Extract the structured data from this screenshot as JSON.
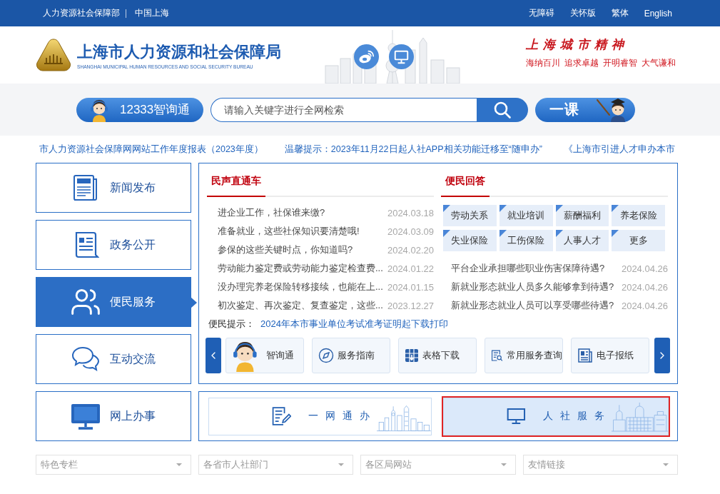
{
  "top_bar": {
    "left_links": [
      "人力资源社会保障部",
      "中国上海"
    ],
    "right_links": [
      "无障碍",
      "关怀版",
      "繁体",
      "English"
    ]
  },
  "header": {
    "title": "上海市人力资源和社会保障局",
    "subtitle": "SHANGHAI MUNICIPAL HUMAN RESOURCES AND SOCIAL SECURITY BUREAU",
    "motto_title": "上海城市精神",
    "mottos": [
      "海纳百川",
      "追求卓越",
      "开明睿智",
      "大气谦和"
    ]
  },
  "search_bar": {
    "hotline_button": "12333智询通",
    "placeholder": "请输入关键字进行全网检索",
    "course_button": "一课"
  },
  "ticker": [
    "市人力资源社会保障网网站工作年度报表（2023年度）",
    "温馨提示：2023年11月22日起人社APP相关功能迁移至“随申办”",
    "《上海市引进人才申办本市"
  ],
  "nav": [
    {
      "label": "新闻发布",
      "selected": false
    },
    {
      "label": "政务公开",
      "selected": false
    },
    {
      "label": "便民服务",
      "selected": true
    },
    {
      "label": "互动交流",
      "selected": false
    },
    {
      "label": "网上办事",
      "selected": false
    }
  ],
  "voice_panel": {
    "title": "民声直通车",
    "items": [
      {
        "text": "进企业工作，社保谁来缴?",
        "date": "2024.03.18"
      },
      {
        "text": "准备就业，这些社保知识要清楚哦!",
        "date": "2024.03.09"
      },
      {
        "text": "参保的这些关键时点，你知道吗?",
        "date": "2024.02.20"
      },
      {
        "text": "劳动能力鉴定费或劳动能力鉴定检查费...",
        "date": "2024.01.22"
      },
      {
        "text": "没办理完养老保险转移接续，也能在上...",
        "date": "2024.01.15"
      },
      {
        "text": "初次鉴定、再次鉴定、复查鉴定，这些...",
        "date": "2023.12.27"
      }
    ]
  },
  "notice": {
    "label": "便民提示：",
    "text": "2024年本市事业单位考试准考证明起下载打印"
  },
  "answers_panel": {
    "title": "便民回答",
    "tags": [
      "劳动关系",
      "就业培训",
      "薪酬福利",
      "养老保险",
      "失业保险",
      "工伤保险",
      "人事人才",
      "更多"
    ],
    "items": [
      {
        "text": "平台企业承担哪些职业伤害保障待遇?",
        "date": "2024.04.26"
      },
      {
        "text": "新就业形态就业人员多久能够拿到待遇?",
        "date": "2024.04.26"
      },
      {
        "text": "新就业形态就业人员可以享受哪些待遇?",
        "date": "2024.04.26"
      }
    ]
  },
  "quick_links": [
    "智询通",
    "服务指南",
    "表格下载",
    "常用服务查询",
    "电子报纸"
  ],
  "banners": [
    {
      "label": "一网通办",
      "selected": false
    },
    {
      "label": "人社服务",
      "selected": true
    }
  ],
  "link_selects": [
    "特色专栏",
    "各省市人社部门",
    "各区局网站",
    "友情链接"
  ]
}
